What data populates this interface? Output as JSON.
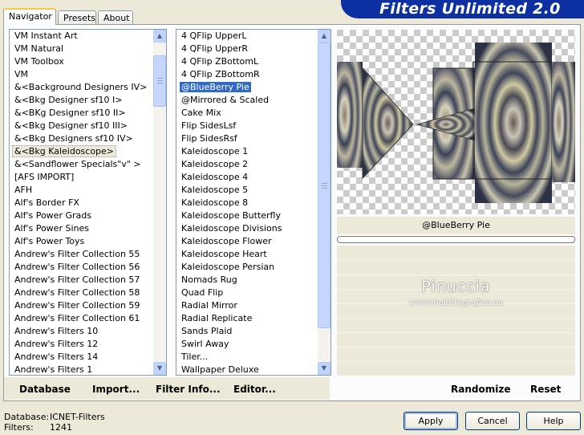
{
  "tabs": [
    "Navigator",
    "Presets",
    "About"
  ],
  "banner_title": "Filters Unlimited 2.0",
  "categories": [
    "VM Instant Art",
    "VM Natural",
    "VM Toolbox",
    "VM",
    "&<Background Designers IV>",
    "&<Bkg Designer sf10 I>",
    "&<BKg Designer sf10 II>",
    "&<Bkg Designer sf10 III>",
    "&<Bkg Designers sf10 IV>",
    "&<Bkg Kaleidoscope>",
    "&<Sandflower Specials\"v\" >",
    "[AFS IMPORT]",
    "AFH",
    "Alf's Border FX",
    "Alf's Power Grads",
    "Alf's Power Sines",
    "Alf's Power Toys",
    "Andrew's Filter Collection 55",
    "Andrew's Filter Collection 56",
    "Andrew's Filter Collection 57",
    "Andrew's Filter Collection 58",
    "Andrew's Filter Collection 59",
    "Andrew's Filter Collection 61",
    "Andrew's Filters 10",
    "Andrew's Filters 12",
    "Andrew's Filters 14",
    "Andrew's Filters 1"
  ],
  "selected_category": "&<Bkg Kaleidoscope>",
  "filters": [
    "4 QFlip UpperL",
    "4 QFlip UpperR",
    "4 QFlip ZBottomL",
    "4 QFlip ZBottomR",
    "@BlueBerry Pie",
    "@Mirrored & Scaled",
    "Cake Mix",
    "Flip SidesLsf",
    "Flip SidesRsf",
    "Kaleidoscope 1",
    "Kaleidoscope 2",
    "Kaleidoscope 4",
    "Kaleidoscope 5",
    "Kaleidoscope 8",
    "Kaleidoscope Butterfly",
    "Kaleidoscope Divisions",
    "Kaleidoscope Flower",
    "Kaleidoscope Heart",
    "Kaleidoscope Persian",
    "Nomads Rug",
    "Quad Flip",
    "Radial Mirror",
    "Radial Replicate",
    "Sands Plaid",
    "Swirl Away",
    "Tiler...",
    "Wallpaper Deluxe"
  ],
  "selected_filter": "@BlueBerry Pie",
  "effect_name": "@BlueBerry Pie",
  "watermark": {
    "name": "Pinuccia",
    "url": "www.maidiregrafica.eu"
  },
  "commands": {
    "database": "Database",
    "import": "Import...",
    "filter_info": "Filter Info...",
    "editor": "Editor...",
    "randomize": "Randomize",
    "reset": "Reset"
  },
  "status": {
    "database_label": "Database:",
    "database_value": "ICNET-Filters",
    "filters_label": "Filters:",
    "filters_value": "1241"
  },
  "buttons": {
    "apply": "Apply",
    "cancel": "Cancel",
    "help": "Help"
  },
  "colors": {
    "banner": "#0c2fa1",
    "selection": "#316ac5",
    "panel": "#ece9d8"
  }
}
